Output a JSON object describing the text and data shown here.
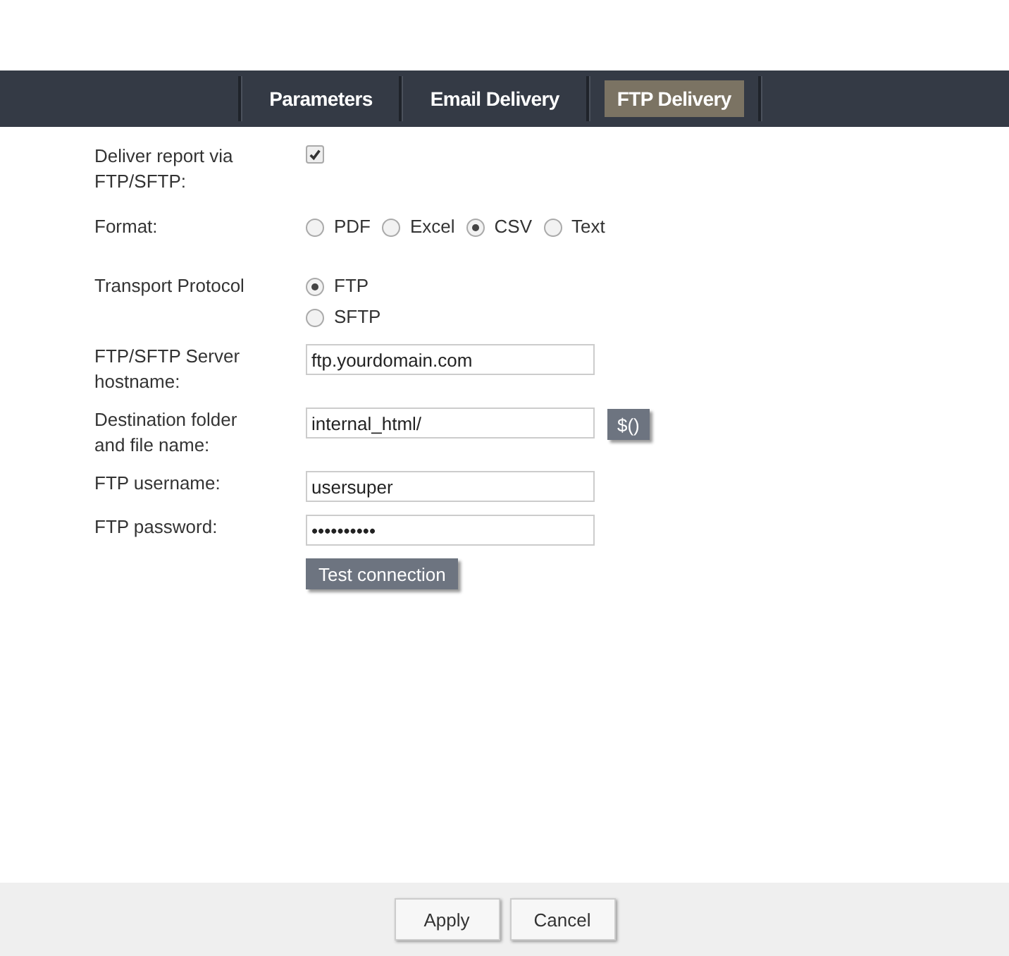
{
  "tabs": [
    {
      "label": "Parameters",
      "selected": false
    },
    {
      "label": "Email Delivery",
      "selected": false
    },
    {
      "label": "FTP Delivery",
      "selected": true
    }
  ],
  "rows": [
    {
      "kind": "checkbox",
      "label": "Deliver report via FTP/SFTP:",
      "checked": true
    },
    {
      "kind": "radio-inline",
      "label": "Format:",
      "options": [
        {
          "label": "PDF",
          "selected": false
        },
        {
          "label": "Excel",
          "selected": false
        },
        {
          "label": "CSV",
          "selected": true
        },
        {
          "label": "Text",
          "selected": false
        }
      ]
    },
    {
      "kind": "radio-stack",
      "label": "Transport Protocol",
      "options": [
        {
          "label": "FTP",
          "selected": true
        },
        {
          "label": "SFTP",
          "selected": false
        }
      ]
    },
    {
      "kind": "text",
      "label": "FTP/SFTP Server hostname:",
      "value": "ftp.yourdomain.com"
    },
    {
      "kind": "text",
      "label": "Destination folder and file name:",
      "value": "internal_html/",
      "button": "$()"
    },
    {
      "kind": "text",
      "label": "FTP username:",
      "value": "usersuper"
    },
    {
      "kind": "text",
      "label": "FTP password:",
      "value": "••••••••••"
    },
    {
      "kind": "action",
      "button": "Test connection"
    }
  ],
  "footer_buttons": [
    "Apply",
    "Cancel"
  ]
}
